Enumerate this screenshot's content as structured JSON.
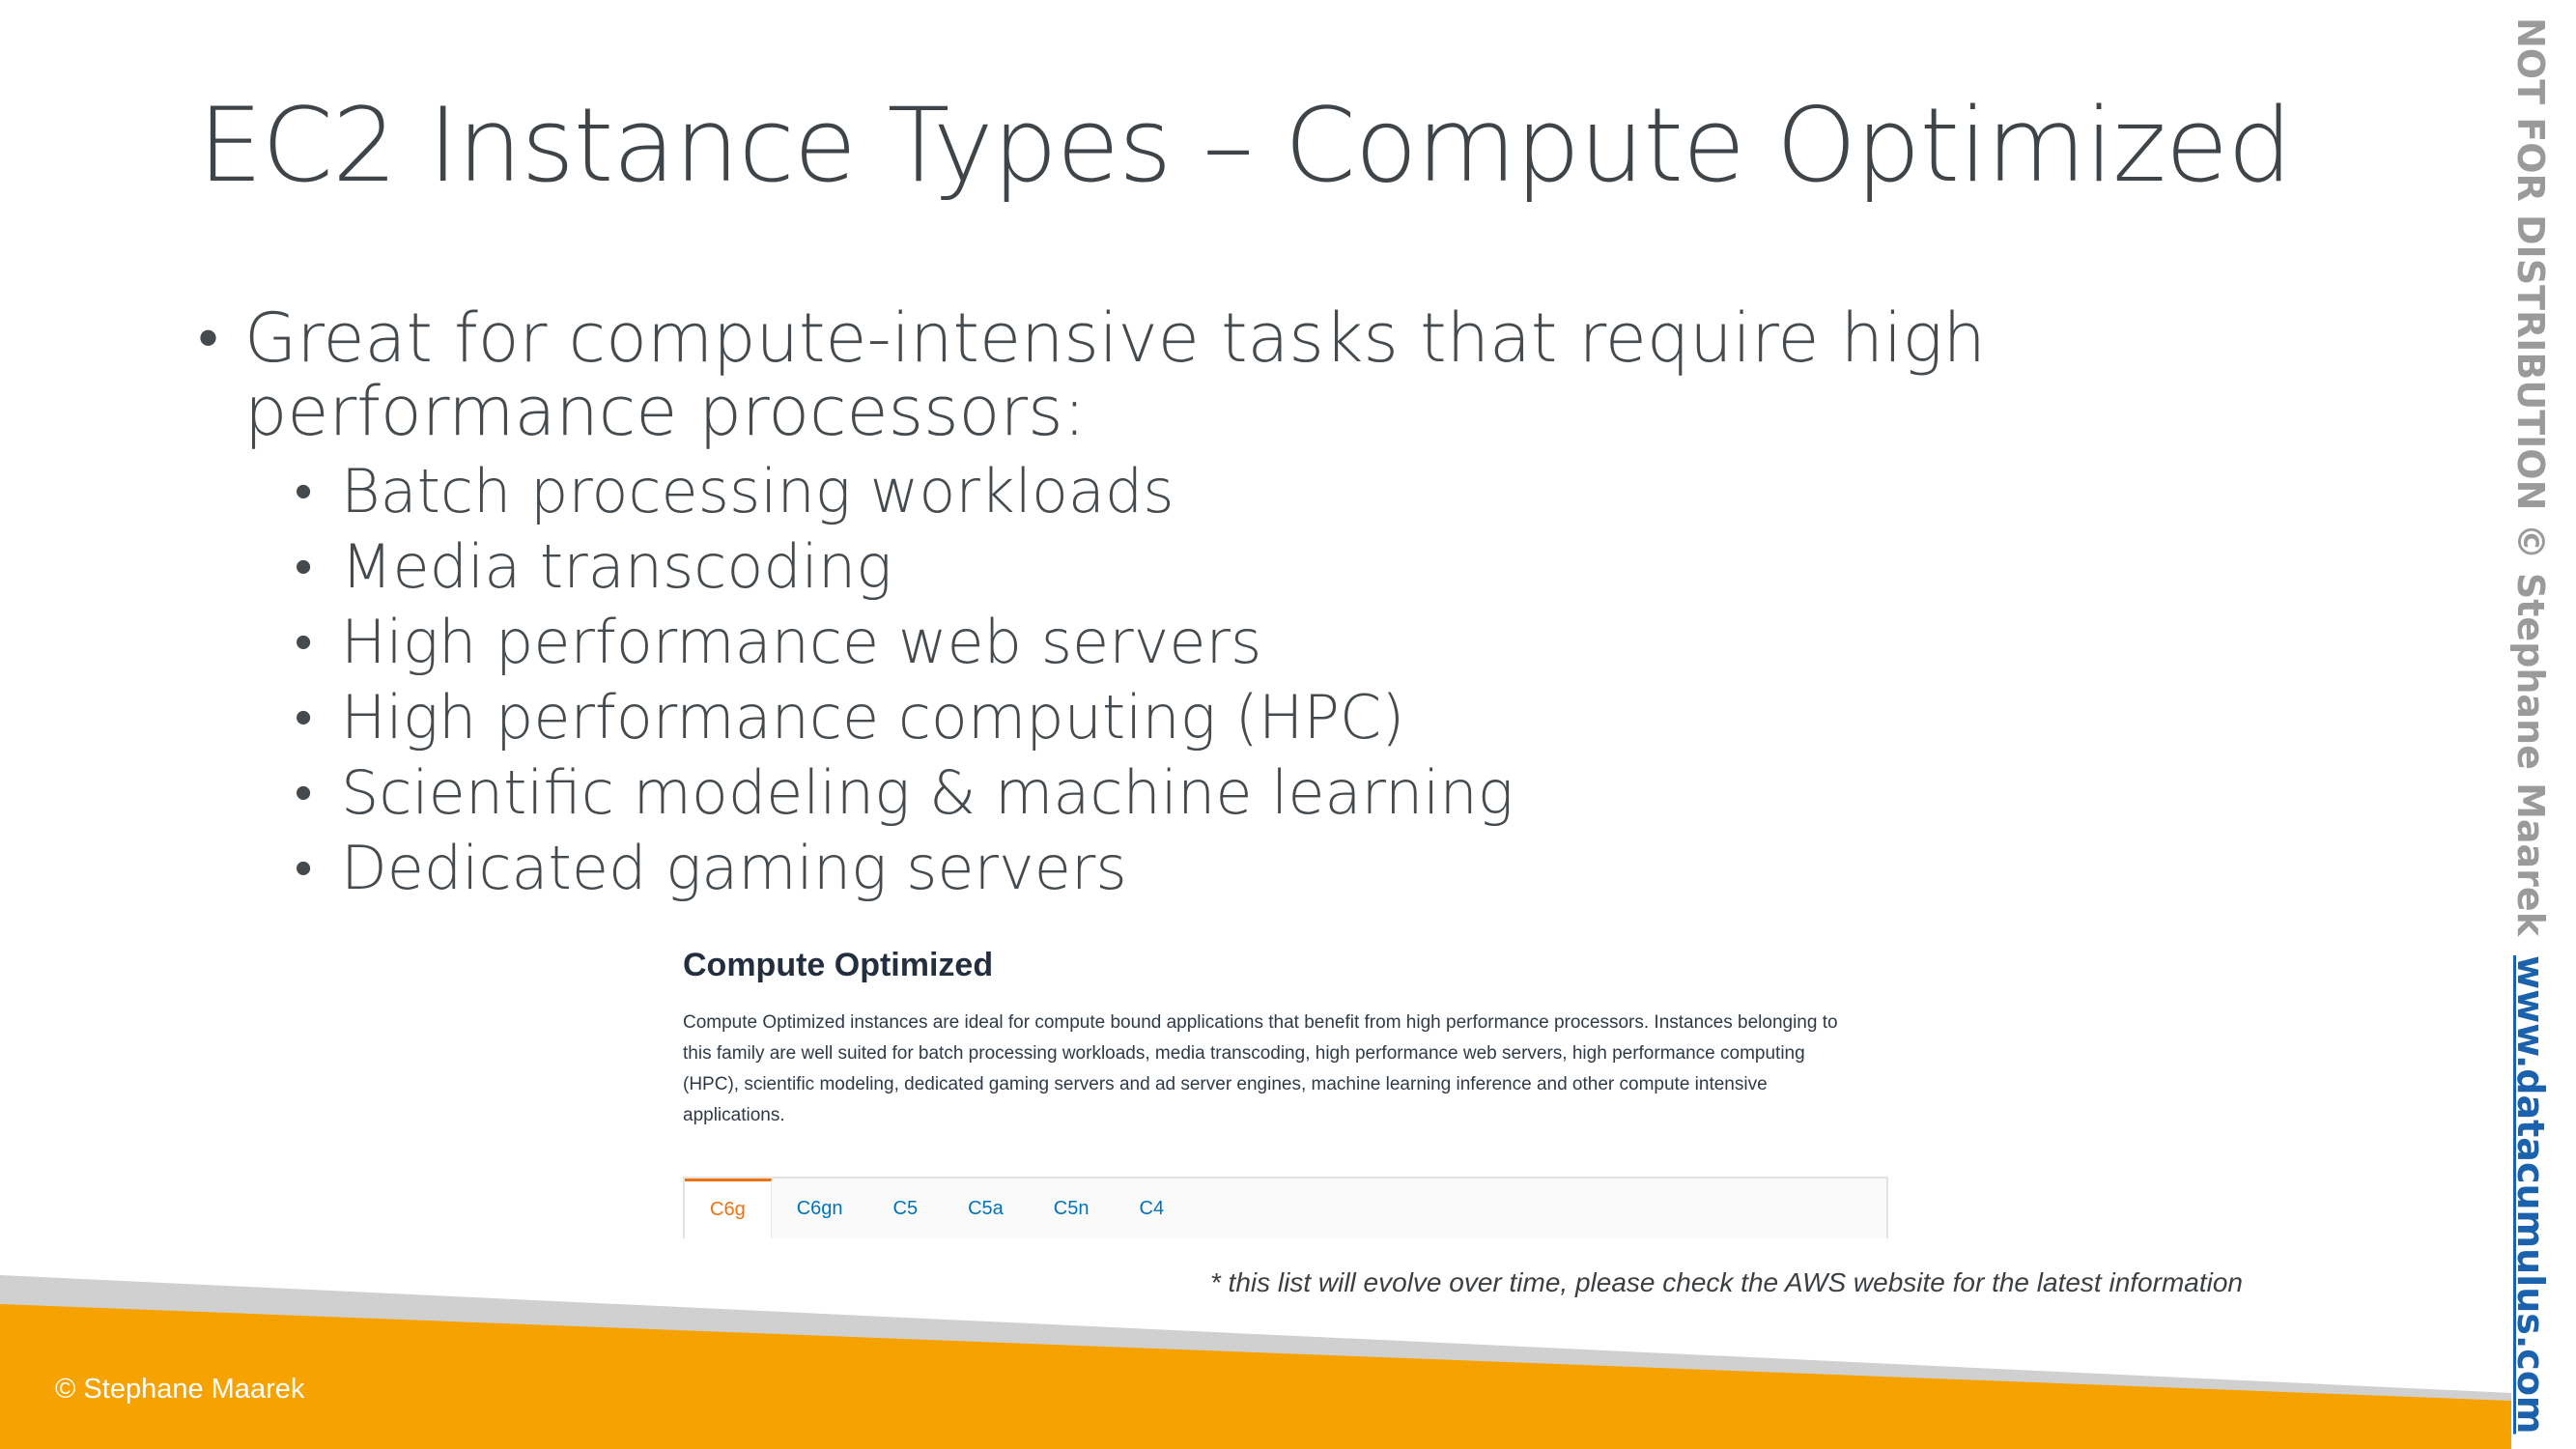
{
  "slide": {
    "title": "EC2 Instance Types – Compute Optimized",
    "bullet_main": "Great for compute-intensive tasks that require high performance processors:",
    "sub_bullets": [
      "Batch processing workloads",
      "Media transcoding",
      "High performance web servers",
      "High performance computing (HPC)",
      "Scientific modeling & machine learning",
      "Dedicated gaming servers"
    ],
    "footnote": "* this list will evolve over time, please check the AWS website for the latest information",
    "copyright": "© Stephane Maarek",
    "watermark": "NOT FOR DISTRIBUTION © Stephane Maarek",
    "watermark_link": "www.datacumulus.com"
  },
  "aws_panel": {
    "heading": "Compute Optimized",
    "description": "Compute Optimized instances are ideal for compute bound applications that benefit from high performance processors. Instances belonging to this family are well suited for batch processing workloads, media transcoding, high performance web servers, high performance computing (HPC), scientific modeling, dedicated gaming servers and ad server engines, machine learning inference and other compute intensive applications.",
    "tabs": [
      "C6g",
      "C6gn",
      "C5",
      "C5a",
      "C5n",
      "C4"
    ],
    "active_tab": "C6g"
  },
  "colors": {
    "footer_orange": "#f6a200",
    "footer_gray": "#d0d0d0",
    "tab_active": "#ec7211",
    "tab_link": "#0073bb",
    "watermark_link": "#1a61ae"
  }
}
